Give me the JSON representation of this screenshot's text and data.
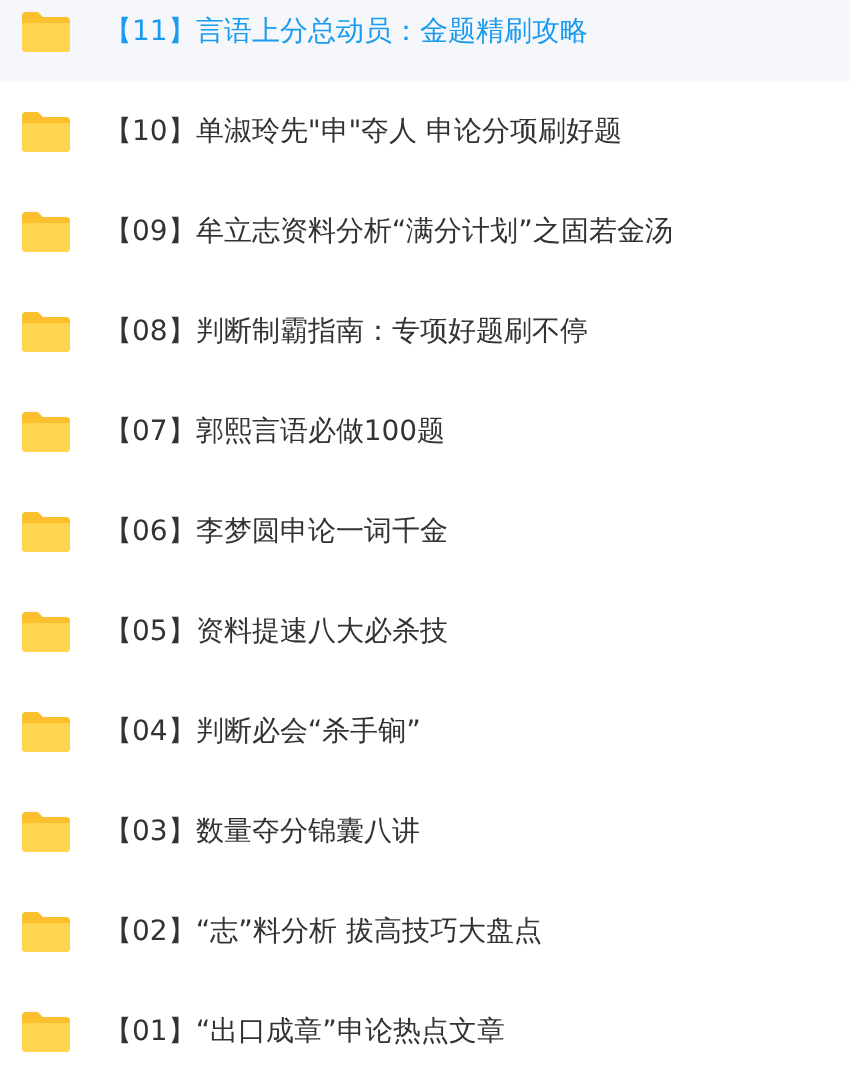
{
  "folders": [
    {
      "name": "【11】言语上分总动员：金题精刷攻略",
      "selected": true
    },
    {
      "name": "【10】单淑玲先\"申\"夺人 申论分项刷好题",
      "selected": false
    },
    {
      "name": "【09】牟立志资料分析“满分计划”之固若金汤",
      "selected": false
    },
    {
      "name": "【08】判断制霸指南：专项好题刷不停",
      "selected": false
    },
    {
      "name": "【07】郭熙言语必做100题",
      "selected": false
    },
    {
      "name": "【06】李梦圆申论一词千金",
      "selected": false
    },
    {
      "name": "【05】资料提速八大必杀技",
      "selected": false
    },
    {
      "name": "【04】判断必会“杀手锏”",
      "selected": false
    },
    {
      "name": "【03】数量夺分锦囊八讲",
      "selected": false
    },
    {
      "name": "【02】“志”料分析 拔高技巧大盘点",
      "selected": false
    },
    {
      "name": "【01】“出口成章”申论热点文章",
      "selected": false
    }
  ]
}
